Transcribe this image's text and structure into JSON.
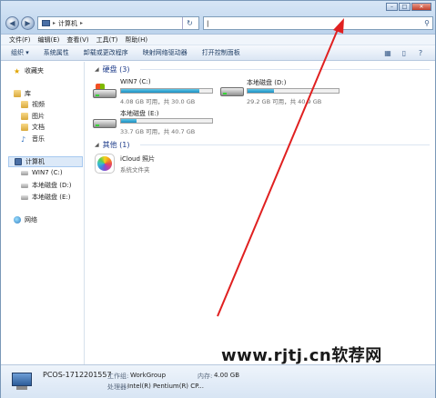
{
  "address": {
    "location": "计算机",
    "sep1": "▸",
    "sep2": "▸"
  },
  "search": {
    "placeholder": "",
    "value": "|"
  },
  "menu": [
    "文件(F)",
    "编辑(E)",
    "查看(V)",
    "工具(T)",
    "帮助(H)"
  ],
  "toolbar": [
    "组织 ▾",
    "系统属性",
    "卸载或更改程序",
    "映射网络驱动器",
    "打开控制面板"
  ],
  "nav": {
    "favorites": "收藏夹",
    "library": "库",
    "library_items": [
      "视频",
      "图片",
      "文档",
      "音乐"
    ],
    "computer": "计算机",
    "drives": [
      "WIN7 (C:)",
      "本地磁盘 (D:)",
      "本地磁盘 (E:)"
    ],
    "network": "网络"
  },
  "groups": {
    "hdd": "硬盘 (3)",
    "other": "其他 (1)"
  },
  "drives": [
    {
      "name": "WIN7 (C:)",
      "size": "4.08 GB 可用，共 30.0 GB",
      "used_fraction": 0.86
    },
    {
      "name": "本地磁盘 (D:)",
      "size": "29.2 GB 可用，共 40.9 GB",
      "used_fraction": 0.29
    },
    {
      "name": "本地磁盘 (E:)",
      "size": "33.7 GB 可用，共 40.7 GB",
      "used_fraction": 0.17
    }
  ],
  "other_items": [
    {
      "name": "iCloud 照片",
      "desc": "系统文件夹"
    }
  ],
  "details": {
    "computer_name": "PCOS-1712201557",
    "workgroup_label": "工作组:",
    "workgroup": "WorkGroup",
    "memory_label": "内存:",
    "memory": "4.00 GB",
    "processor_label": "处理器:",
    "processor": "Intel(R) Pentium(R) CP..."
  },
  "watermark": "www.rjtj.cn软荐网",
  "colors": {
    "accent": "#1c8fc2",
    "arrow": "#e02020"
  }
}
